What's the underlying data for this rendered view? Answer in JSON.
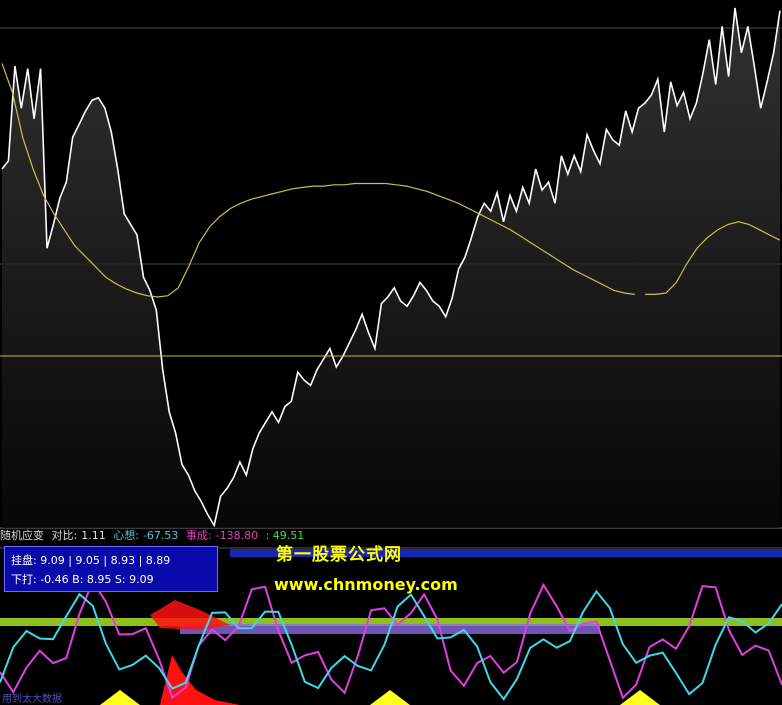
{
  "chart_data": {
    "type": "line",
    "main": {
      "price": [
        272,
        278,
        350,
        318,
        348,
        310,
        348,
        212,
        230,
        250,
        262,
        296,
        306,
        316,
        324,
        326,
        318,
        300,
        272,
        238,
        230,
        222,
        190,
        180,
        165,
        120,
        88,
        72,
        48,
        40,
        28,
        20,
        10,
        2,
        24,
        30,
        38,
        50,
        40,
        60,
        72,
        80,
        88,
        80,
        92,
        96,
        118,
        112,
        108,
        120,
        128,
        136,
        122,
        130,
        140,
        150,
        162,
        148,
        136,
        170,
        175,
        182,
        172,
        168,
        176,
        186,
        180,
        172,
        168,
        160,
        174,
        196,
        205,
        220,
        236,
        246,
        240,
        254,
        232,
        252,
        240,
        258,
        246,
        272,
        256,
        262,
        246,
        282,
        268,
        282,
        270,
        298,
        286,
        276,
        302,
        294,
        290,
        316,
        300,
        318,
        322,
        328,
        340,
        300,
        338,
        320,
        330,
        310,
        322,
        344,
        370,
        336,
        380,
        342,
        394,
        360,
        380,
        350,
        318,
        338,
        360,
        392
      ],
      "avg": [
        352,
        330,
        296,
        272,
        252,
        238,
        226,
        214,
        206,
        198,
        190,
        185,
        181,
        178,
        176,
        175,
        176,
        182,
        198,
        216,
        228,
        236,
        242,
        246,
        249,
        251,
        253,
        255,
        257,
        258,
        259,
        259,
        260,
        260,
        261,
        261,
        261,
        261,
        260,
        259,
        257,
        255,
        252,
        249,
        246,
        242,
        238,
        234,
        230,
        226,
        221,
        216,
        211,
        206,
        201,
        196,
        192,
        188,
        184,
        180,
        178,
        177,
        177,
        177,
        178,
        186,
        200,
        212,
        220,
        226,
        230,
        232,
        230,
        226,
        222,
        218
      ]
    },
    "indicator_bar": {
      "name": "随机应变",
      "ratio_label": "对比:",
      "ratio_value": "1.11",
      "xin_label": "心想:",
      "xin_value": "-67.53",
      "shi_label": "事成:",
      "shi_value": "-138.80",
      "end_value": ": 49.51"
    },
    "info_box": {
      "line1": "挂盘: 9.09 | 9.05 | 8.93 | 8.89",
      "line2": "下打: -0.46  B: 8.95  S: 9.09"
    },
    "watermark": {
      "line1": "第一股票公式网",
      "line2": "www.chnmoney.com"
    },
    "footer_text": "用到太大数据",
    "colors": {
      "price": "#ffffff",
      "avg": "#c8c050",
      "ref": "#c8c030",
      "magenta": "#e040e0",
      "cyan": "#40d8e8",
      "green_band": "#a8e020",
      "violet_band": "#8a6ae0",
      "red_peak": "#ff1010",
      "yellow_fill": "#ffff20",
      "blue_top": "#2030e0"
    }
  }
}
